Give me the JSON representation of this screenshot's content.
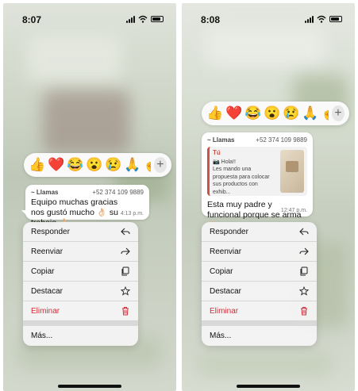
{
  "left": {
    "time": "8:07",
    "reactions": [
      "👍",
      "❤️",
      "😂",
      "😮",
      "😢",
      "🙏",
      "🤞"
    ],
    "message": {
      "sender": "~ Llamas",
      "phone": "+52 374 109 9889",
      "text": "Equipo muchas gracias nos gustó mucho 👌🏻 su trabajo 👌🏻",
      "time": "4:13 p.m."
    },
    "menu": {
      "reply": "Responder",
      "forward": "Reenviar",
      "copy": "Copiar",
      "star": "Destacar",
      "delete": "Eliminar",
      "more": "Más..."
    }
  },
  "right": {
    "time": "8:08",
    "reactions": [
      "👍",
      "❤️",
      "😂",
      "😮",
      "😢",
      "🙏",
      "🤞"
    ],
    "message": {
      "sender": "~ Llamas",
      "phone": "+52 374 109 9889",
      "quote_author": "Tú",
      "quote_line1": "📷 Hola!!",
      "quote_line2": "Les mando una propuesta para colocar sus productos con exhib...",
      "text": "Esta muy padre y funcional porque se arma 👌🏻",
      "time": "12:47 p.m."
    },
    "menu": {
      "reply": "Responder",
      "forward": "Reenviar",
      "copy": "Copiar",
      "star": "Destacar",
      "delete": "Eliminar",
      "more": "Más..."
    }
  },
  "colors": {
    "danger": "#d12f3b",
    "quote_accent": "#c9534a"
  },
  "icons": [
    "signal-icon",
    "wifi-icon",
    "battery-icon",
    "plus-icon",
    "reply-icon",
    "forward-icon",
    "copy-icon",
    "star-icon",
    "trash-icon"
  ]
}
